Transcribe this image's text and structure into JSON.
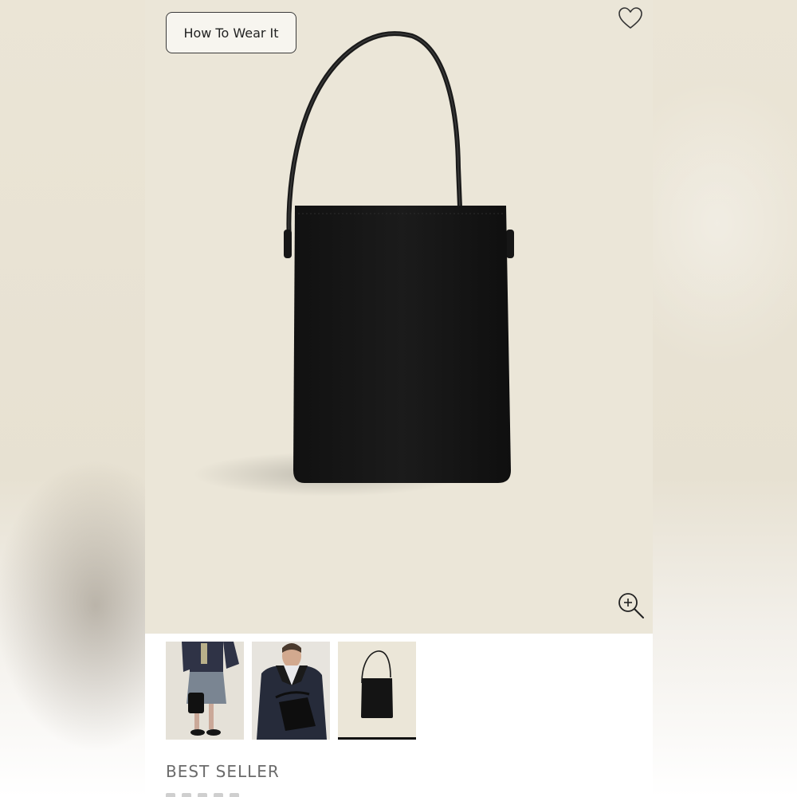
{
  "hero": {
    "how_to_wear_label": "How To Wear It",
    "favorite_icon": "heart-outline-icon",
    "zoom_icon": "zoom-in-icon"
  },
  "thumbnails": [
    {
      "name": "outfit-photo-skirt"
    },
    {
      "name": "outfit-photo-jacket"
    },
    {
      "name": "product-photo-bag",
      "selected": true
    }
  ],
  "product": {
    "badge": "BEST SELLER"
  },
  "colors": {
    "hero_background": "#ebe6d8",
    "bag": "#141414",
    "badge_text": "#6b6b6b"
  }
}
